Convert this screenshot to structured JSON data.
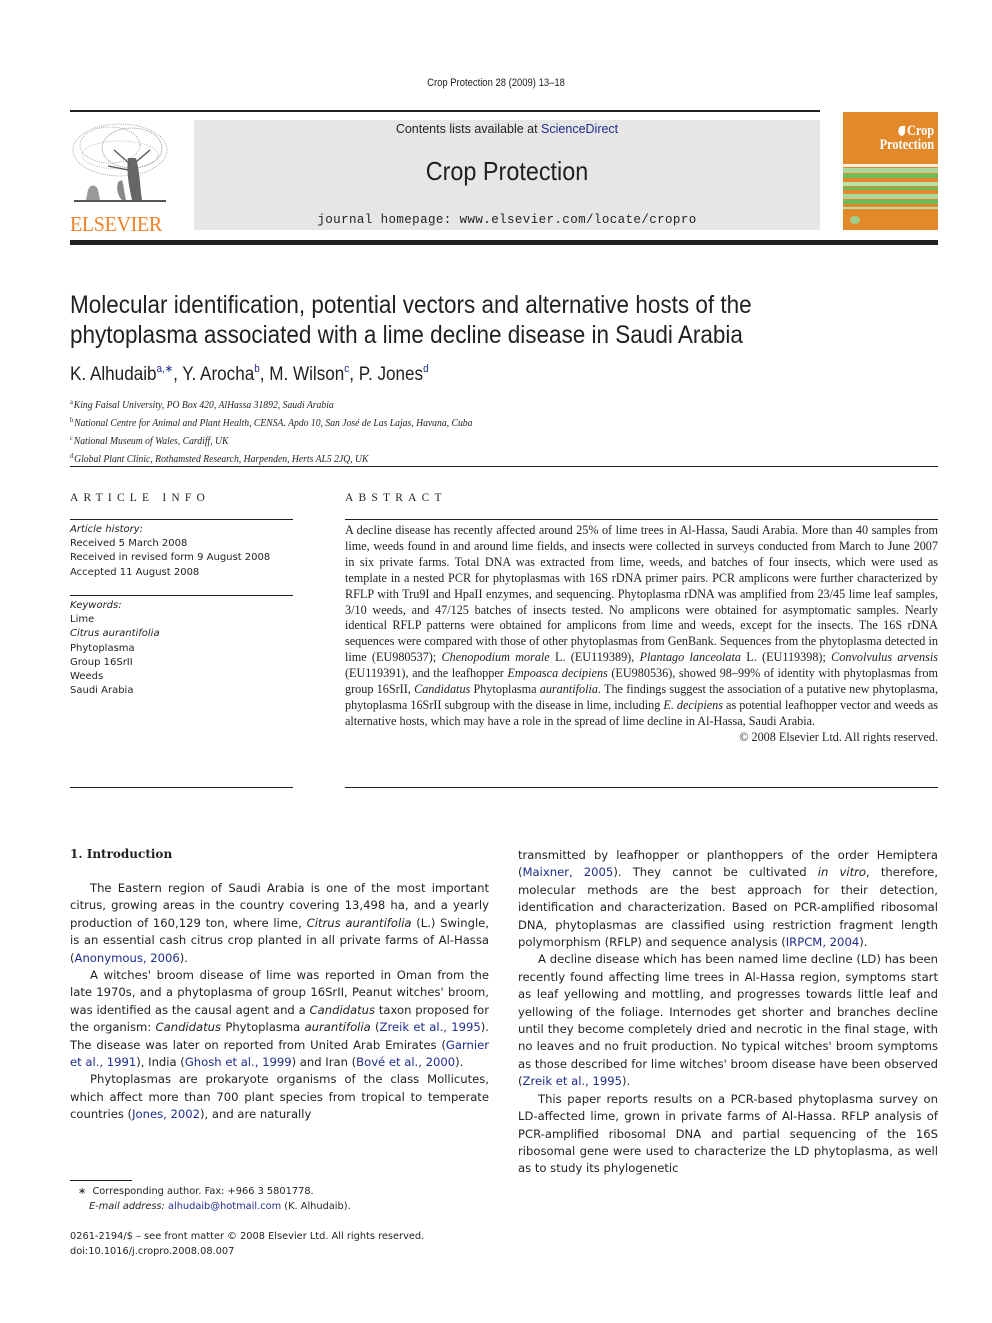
{
  "running_head": "Crop Protection 28 (2009) 13–18",
  "masthead": {
    "publisher_wordmark": "ELSEVIER",
    "contents_prefix": "Contents lists available at ",
    "contents_link": "ScienceDirect",
    "journal_title": "Crop Protection",
    "homepage_prefix": "journal homepage: ",
    "homepage_url": "www.elsevier.com/locate/cropro",
    "cover_title_line1": "Crop",
    "cover_title_line2": "Protection",
    "colors": {
      "publisher_orange": "#f47f24",
      "masthead_gray": "#e6e6e6",
      "cover_orange": "#e28a2b",
      "cover_green": "#6dbb5a",
      "link_blue": "#1d2c8c"
    }
  },
  "article": {
    "title_line1": "Molecular identification, potential vectors and alternative hosts of the",
    "title_line2": "phytoplasma associated with a lime decline disease in Saudi Arabia",
    "authors": [
      {
        "name": "K. Alhudaib",
        "sup": "a,∗",
        "sep": ", "
      },
      {
        "name": "Y. Arocha",
        "sup": "b",
        "sep": ", "
      },
      {
        "name": "M. Wilson",
        "sup": "c",
        "sep": ", "
      },
      {
        "name": "P. Jones",
        "sup": "d",
        "sep": ""
      }
    ],
    "affiliations": [
      {
        "key": "a",
        "text": "King Faisal University, PO Box 420, AlHassa 31892, Saudi Arabia"
      },
      {
        "key": "b",
        "text": "National Centre for Animal and Plant Health, CENSA. Apdo 10, San José de Las Lajas, Havana, Cuba"
      },
      {
        "key": "c",
        "text": "National Museum of Wales, Cardiff, UK"
      },
      {
        "key": "d",
        "text": "Global Plant Clinic, Rothamsted Research, Harpenden, Herts AL5 2JQ, UK"
      }
    ]
  },
  "article_info": {
    "heading": "ARTICLE INFO",
    "history_label": "Article history:",
    "history": [
      "Received 5 March 2008",
      "Received in revised form 9 August 2008",
      "Accepted 11 August 2008"
    ],
    "keywords_label": "Keywords:",
    "keywords": [
      {
        "text": "Lime",
        "italic": false
      },
      {
        "text": "Citrus aurantifolia",
        "italic": true
      },
      {
        "text": "Phytoplasma",
        "italic": false
      },
      {
        "text": "Group 16SrII",
        "italic": false
      },
      {
        "text": "Weeds",
        "italic": false
      },
      {
        "text": "Saudi Arabia",
        "italic": false
      }
    ]
  },
  "abstract": {
    "heading": "ABSTRACT",
    "segments": [
      {
        "t": "A decline disease has recently affected around 25% of lime trees in Al-Hassa, Saudi Arabia. More than 40 samples from lime, weeds found in and around lime fields, and insects were collected in surveys conducted from March to June 2007 in six private farms. Total DNA was extracted from lime, weeds, and batches of four insects, which were used as template in a nested PCR for phytoplasmas with 16S rDNA primer pairs. PCR amplicons were further characterized by RFLP with Tru9I and HpaII enzymes, and sequencing. Phytoplasma rDNA was amplified from 23/45 lime leaf samples, 3/10 weeds, and 47/125 batches of insects tested. No amplicons were obtained for asymptomatic samples. Nearly identical RFLP patterns were obtained for amplicons from lime and weeds, except for the insects. The 16S rDNA sequences were compared with those of other phytoplasmas from GenBank. Sequences from the phytoplasma detected in lime (EU980537); "
      },
      {
        "t": "Chenopodium morale",
        "i": true
      },
      {
        "t": " L. (EU119389), "
      },
      {
        "t": "Plantago lanceolata",
        "i": true
      },
      {
        "t": " L. (EU119398); "
      },
      {
        "t": "Convolvulus arvensis",
        "i": true
      },
      {
        "t": " (EU119391), and the leafhopper "
      },
      {
        "t": "Empoasca decipiens",
        "i": true
      },
      {
        "t": " (EU980536), showed 98–99% of identity with phytoplasmas from group 16SrII, "
      },
      {
        "t": "Candidatus",
        "i": true
      },
      {
        "t": " Phytoplasma "
      },
      {
        "t": "aurantifolia",
        "i": true
      },
      {
        "t": ". The findings suggest the association of a putative new phytoplasma, phytoplasma 16SrII subgroup with the disease in lime, including "
      },
      {
        "t": "E. decipiens",
        "i": true
      },
      {
        "t": " as potential leafhopper vector and weeds as alternative hosts, which may have a role in the spread of lime decline in Al-Hassa, Saudi Arabia."
      }
    ],
    "copyright": "© 2008 Elsevier Ltd. All rights reserved."
  },
  "introduction": {
    "heading": "1.  Introduction",
    "left_paragraphs": [
      [
        {
          "t": "The Eastern region of Saudi Arabia is one of the most important citrus, growing areas in the country covering 13,498 ha, and a yearly production of 160,129 ton, where lime, "
        },
        {
          "t": "Citrus aurantifolia",
          "i": true
        },
        {
          "t": " (L.) Swingle, is an essential cash citrus crop planted in all private farms of Al-Hassa ("
        },
        {
          "t": "Anonymous, 2006",
          "link": true
        },
        {
          "t": ")."
        }
      ],
      [
        {
          "t": "A witches' broom disease of lime was reported in Oman from the late 1970s, and a phytoplasma of group 16SrII, Peanut witches' broom, was identified as the causal agent and a "
        },
        {
          "t": "Candidatus",
          "i": true
        },
        {
          "t": " taxon proposed for the organism: "
        },
        {
          "t": "Candidatus",
          "i": true
        },
        {
          "t": " Phytoplasma "
        },
        {
          "t": "aurantifolia",
          "i": true
        },
        {
          "t": " ("
        },
        {
          "t": "Zreik et al., 1995",
          "link": true
        },
        {
          "t": "). The disease was later on reported from United Arab Emirates ("
        },
        {
          "t": "Garnier et al., 1991",
          "link": true
        },
        {
          "t": "), India ("
        },
        {
          "t": "Ghosh et al., 1999",
          "link": true
        },
        {
          "t": ") and Iran ("
        },
        {
          "t": "Bové et al., 2000",
          "link": true
        },
        {
          "t": ")."
        }
      ],
      [
        {
          "t": "Phytoplasmas are prokaryote organisms of the class Mollicutes, which affect more than 700 plant species from tropical to temperate countries ("
        },
        {
          "t": "Jones, 2002",
          "link": true
        },
        {
          "t": "), and are naturally"
        }
      ]
    ],
    "right_paragraphs": [
      [
        {
          "t": "transmitted by leafhopper or planthoppers of the order Hemiptera ("
        },
        {
          "t": "Maixner, 2005",
          "link": true
        },
        {
          "t": "). They cannot be cultivated "
        },
        {
          "t": "in vitro",
          "i": true
        },
        {
          "t": ", therefore, molecular methods are the best approach for their detection, identification and characterization. Based on PCR-amplified ribosomal DNA, phytoplasmas are classified using restriction fragment length polymorphism (RFLP) and sequence analysis ("
        },
        {
          "t": "IRPCM, 2004",
          "link": true
        },
        {
          "t": ")."
        }
      ],
      [
        {
          "t": "A decline disease which has been named lime decline (LD) has been recently found affecting lime trees in Al-Hassa region, symptoms start as leaf yellowing and mottling, and progresses towards little leaf and yellowing of the foliage. Internodes get shorter and branches decline until they become completely dried and necrotic in the final stage, with no leaves and no fruit production. No typical witches' broom symptoms as those described for lime witches' broom disease have been observed ("
        },
        {
          "t": "Zreik et al., 1995",
          "link": true
        },
        {
          "t": ")."
        }
      ],
      [
        {
          "t": "This paper reports results on a PCR-based phytoplasma survey on LD-affected lime, grown in private farms of Al-Hassa. RFLP analysis of PCR-amplified ribosomal DNA and partial sequencing of the 16S ribosomal gene were used to characterize the LD phytoplasma, as well as to study its phylogenetic"
        }
      ]
    ]
  },
  "footnote": {
    "marker": "∗",
    "corresponding": "Corresponding author. Fax: +966 3 5801778.",
    "email_label": "E-mail address:",
    "email": "alhudaib@hotmail.com",
    "email_suffix": " (K. Alhudaib)."
  },
  "front_matter": {
    "issn_line": "0261-2194/$ – see front matter © 2008 Elsevier Ltd. All rights reserved.",
    "doi": "doi:10.1016/j.cropro.2008.08.007"
  }
}
